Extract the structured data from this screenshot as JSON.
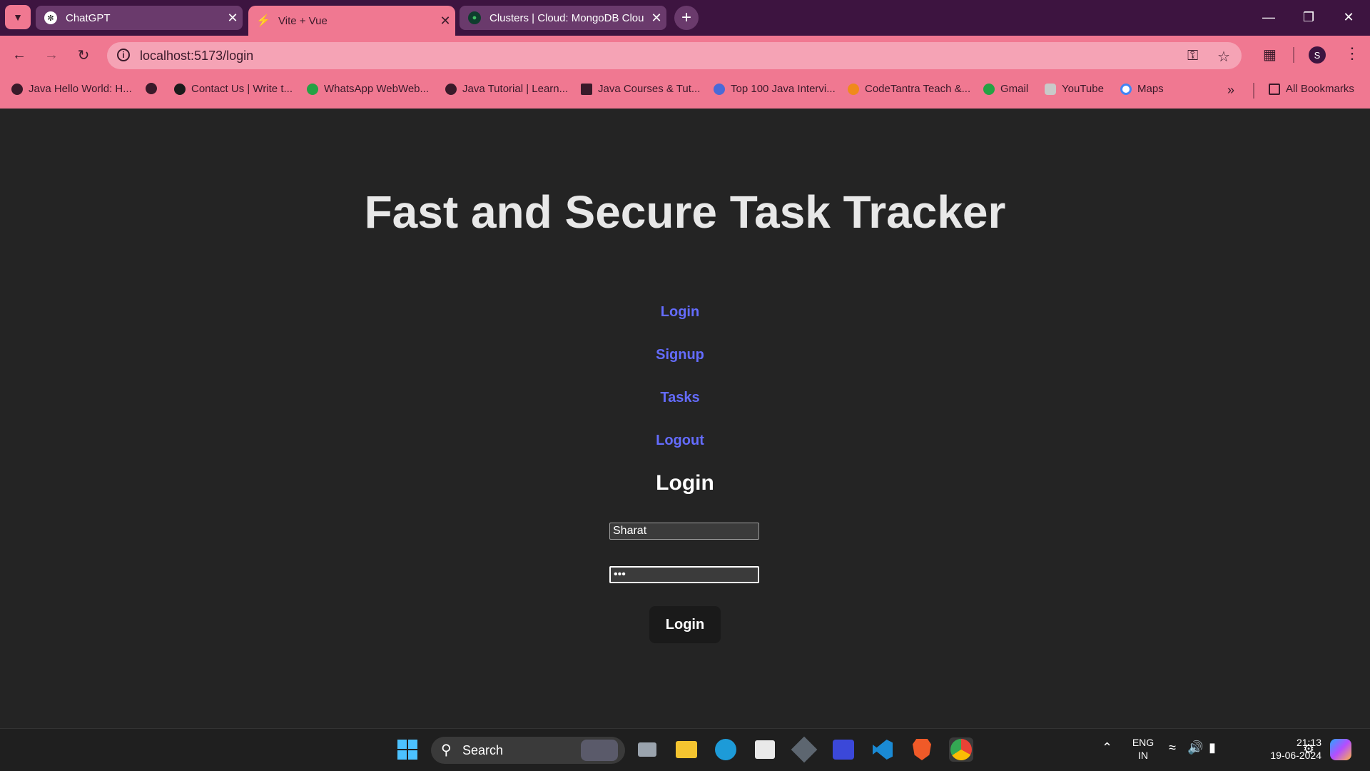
{
  "browser": {
    "tabs": [
      {
        "title": "ChatGPT",
        "active": false
      },
      {
        "title": "Vite + Vue",
        "active": true
      },
      {
        "title": "Clusters | Cloud: MongoDB Clou",
        "active": false
      }
    ],
    "url": "localhost:5173/login",
    "profile_initial": "S",
    "bookmarks": [
      "Java Hello World: H...",
      "Contact Us | Write t...",
      "WhatsApp WebWeb...",
      "Java Tutorial | Learn...",
      "Java Courses & Tut...",
      "Top 100 Java Intervi...",
      "CodeTantra Teach &...",
      "Gmail",
      "YouTube",
      "Maps"
    ],
    "all_bookmarks": "All Bookmarks"
  },
  "page": {
    "title": "Fast and Secure Task Tracker",
    "nav": [
      "Login",
      "Signup",
      "Tasks",
      "Logout"
    ],
    "form": {
      "heading": "Login",
      "username_value": "Sharat",
      "password_value": "•••",
      "submit_label": "Login"
    }
  },
  "taskbar": {
    "search_label": "Search",
    "lang_top": "ENG",
    "lang_bottom": "IN",
    "time": "21:13",
    "date": "19-06-2024"
  },
  "colors": {
    "tab_strip": "#3d1440",
    "chrome_pink": "#f07891",
    "page_bg": "#242424",
    "link": "#646cff"
  }
}
